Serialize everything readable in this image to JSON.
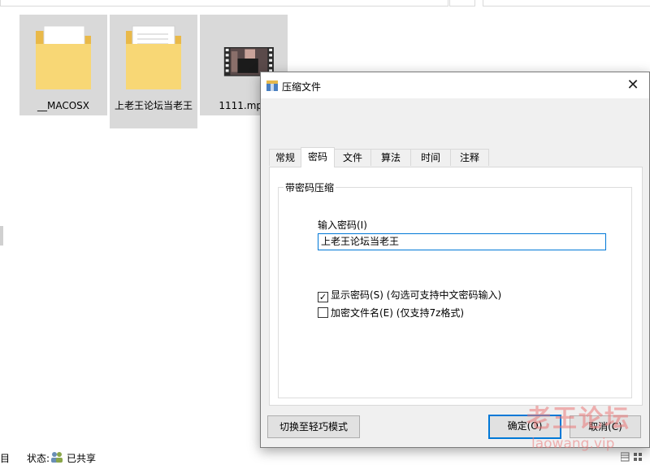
{
  "explorer": {
    "files": [
      {
        "name": "__MACOSX",
        "kind": "folder"
      },
      {
        "name": "上老王论坛当老王",
        "kind": "folder"
      },
      {
        "name": "1111.mp4",
        "kind": "video"
      }
    ]
  },
  "statusbar": {
    "left_text": "目",
    "status_label": "状态:",
    "shared_text": "已共享"
  },
  "dialog": {
    "title": "压缩文件",
    "close_glyph": "✕",
    "tabs": [
      "常规",
      "密码",
      "文件",
      "算法",
      "时间",
      "注释"
    ],
    "active_tab": "密码",
    "group_title": "带密码压缩",
    "password_label": "输入密码(I)",
    "password_value": "上老王论坛当老王",
    "show_password": {
      "label": "显示密码(S)  (勾选可支持中文密码输入)",
      "checked": true,
      "check_glyph": "✓"
    },
    "encrypt_names": {
      "label": "加密文件名(E)  (仅支持7z格式)",
      "checked": false
    },
    "buttons": {
      "switch_mode": "切换至轻巧模式",
      "ok": "确定(O)",
      "cancel": "取消(C)"
    }
  },
  "watermark": {
    "line1": "老王论坛",
    "line2": "laowang.vip"
  },
  "colors": {
    "accent": "#0078d7",
    "selection": "#cce8ff",
    "folder": "#f8d775"
  }
}
